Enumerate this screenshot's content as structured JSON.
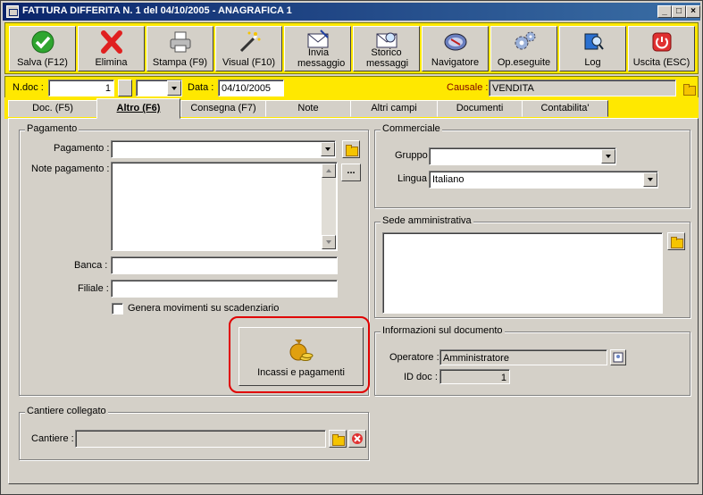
{
  "window": {
    "title": "FATTURA DIFFERITA N. 1  del 04/10/2005 - ANAGRAFICA 1"
  },
  "titlebar_buttons": {
    "minimize": "_",
    "maximize": "□",
    "close": "×"
  },
  "toolbar": [
    {
      "label": "Salva (F12)",
      "icon": "check-icon"
    },
    {
      "label": "Elimina",
      "icon": "delete-x-icon"
    },
    {
      "label": "Stampa (F9)",
      "icon": "printer-icon"
    },
    {
      "label": "Visual (F10)",
      "icon": "magic-wand-icon"
    },
    {
      "label": "Invia messaggio",
      "icon": "envelope-icon"
    },
    {
      "label": "Storico messaggi",
      "icon": "envelope-search-icon"
    },
    {
      "label": "Navigatore",
      "icon": "compass-icon"
    },
    {
      "label": "Op.eseguite",
      "icon": "gears-icon"
    },
    {
      "label": "Log",
      "icon": "book-search-icon"
    },
    {
      "label": "Uscita (ESC)",
      "icon": "power-icon"
    }
  ],
  "header": {
    "ndoc_label": "N.doc :",
    "ndoc_value": "1",
    "data_label": "Data :",
    "data_value": "04/10/2005",
    "causale_label": "Causale :",
    "causale_value": "VENDITA"
  },
  "tabs": [
    {
      "label": "Doc. (F5)",
      "active": false
    },
    {
      "label": "Altro (F6)",
      "active": true
    },
    {
      "label": "Consegna (F7)",
      "active": false
    },
    {
      "label": "Note",
      "active": false
    },
    {
      "label": "Altri campi",
      "active": false
    },
    {
      "label": "Documenti",
      "active": false
    },
    {
      "label": "Contabilita'",
      "active": false
    }
  ],
  "pagamento": {
    "group_title": "Pagamento",
    "pagamento_label": "Pagamento :",
    "pagamento_value": "",
    "note_label": "Note pagamento :",
    "note_value": "",
    "ellipsis": "...",
    "banca_label": "Banca :",
    "banca_value": "",
    "filiale_label": "Filiale :",
    "filiale_value": "",
    "checkbox_label": "Genera movimenti su scadenziario",
    "incassi_label": "Incassi e pagamenti"
  },
  "cantiere": {
    "group_title": "Cantiere collegato",
    "label": "Cantiere :",
    "value": ""
  },
  "commerciale": {
    "group_title": "Commerciale",
    "gruppo_label": "Gruppo",
    "gruppo_value": "",
    "lingua_label": "Lingua",
    "lingua_value": "Italiano"
  },
  "sede": {
    "group_title": "Sede amministrativa",
    "value": ""
  },
  "info": {
    "group_title": "Informazioni sul documento",
    "operatore_label": "Operatore :",
    "operatore_value": "Amministratore",
    "iddoc_label": "ID doc :",
    "iddoc_value": "1"
  },
  "colors": {
    "accent_yellow": "#ffe800",
    "highlight_red": "#e00000",
    "title_blue": "#0a246a"
  }
}
